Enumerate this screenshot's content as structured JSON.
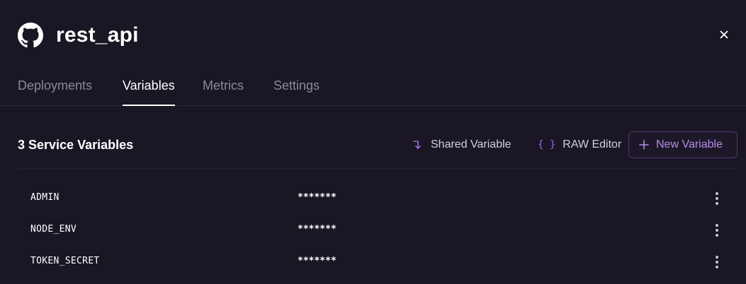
{
  "service": {
    "title": "rest_api",
    "icon": "github-icon"
  },
  "tabs": [
    {
      "label": "Deployments",
      "active": false
    },
    {
      "label": "Variables",
      "active": true
    },
    {
      "label": "Metrics",
      "active": false
    },
    {
      "label": "Settings",
      "active": false
    }
  ],
  "variables_section": {
    "title": "3 Service Variables",
    "actions": {
      "shared_variable": "Shared Variable",
      "raw_editor": "RAW Editor",
      "new_variable": "New Variable"
    }
  },
  "variables": [
    {
      "name": "ADMIN",
      "value": "*******"
    },
    {
      "name": "NODE_ENV",
      "value": "*******"
    },
    {
      "name": "TOKEN_SECRET",
      "value": "*******"
    }
  ],
  "colors": {
    "background": "#1a1624",
    "accent": "#b68cf0",
    "muted_text": "#8d8899"
  }
}
